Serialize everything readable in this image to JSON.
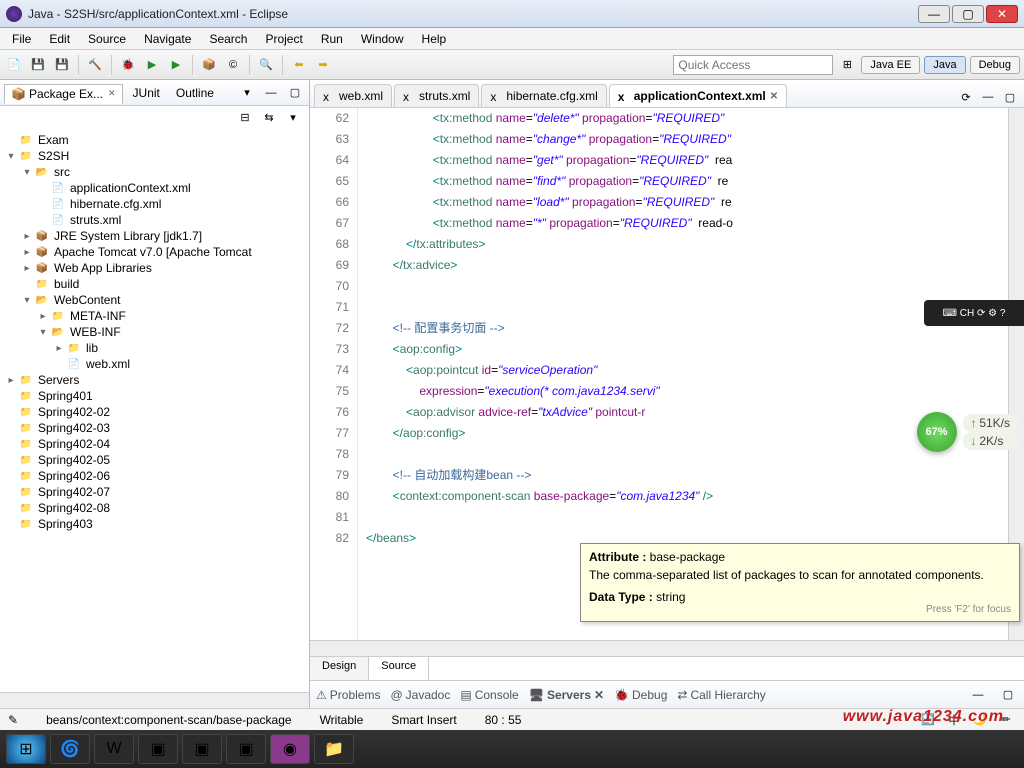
{
  "window": {
    "title": "Java - S2SH/src/applicationContext.xml - Eclipse"
  },
  "menu": [
    "File",
    "Edit",
    "Source",
    "Navigate",
    "Search",
    "Project",
    "Run",
    "Window",
    "Help"
  ],
  "quick_access": {
    "placeholder": "Quick Access"
  },
  "perspectives": {
    "java_ee": "Java EE",
    "java": "Java",
    "debug": "Debug"
  },
  "sidebar": {
    "tabs": {
      "package_explorer": "Package Ex...",
      "junit": "JUnit",
      "outline": "Outline"
    },
    "tree": [
      {
        "d": 0,
        "a": "",
        "i": "project-icon",
        "t": "Exam"
      },
      {
        "d": 0,
        "a": "▾",
        "i": "project-icon",
        "t": "S2SH"
      },
      {
        "d": 1,
        "a": "▾",
        "i": "folder-open",
        "t": "src"
      },
      {
        "d": 2,
        "a": "",
        "i": "file-icon",
        "t": "applicationContext.xml"
      },
      {
        "d": 2,
        "a": "",
        "i": "file-icon",
        "t": "hibernate.cfg.xml"
      },
      {
        "d": 2,
        "a": "",
        "i": "file-icon",
        "t": "struts.xml"
      },
      {
        "d": 1,
        "a": "▸",
        "i": "jar-icon",
        "t": "JRE System Library [jdk1.7]"
      },
      {
        "d": 1,
        "a": "▸",
        "i": "jar-icon",
        "t": "Apache Tomcat v7.0 [Apache Tomcat"
      },
      {
        "d": 1,
        "a": "▸",
        "i": "jar-icon",
        "t": "Web App Libraries"
      },
      {
        "d": 1,
        "a": "",
        "i": "folder-icon",
        "t": "build"
      },
      {
        "d": 1,
        "a": "▾",
        "i": "folder-open",
        "t": "WebContent"
      },
      {
        "d": 2,
        "a": "▸",
        "i": "folder-icon",
        "t": "META-INF"
      },
      {
        "d": 2,
        "a": "▾",
        "i": "folder-open",
        "t": "WEB-INF"
      },
      {
        "d": 3,
        "a": "▸",
        "i": "folder-icon",
        "t": "lib"
      },
      {
        "d": 3,
        "a": "",
        "i": "file-icon",
        "t": "web.xml"
      },
      {
        "d": 0,
        "a": "▸",
        "i": "folder-icon",
        "t": "Servers"
      },
      {
        "d": 0,
        "a": "",
        "i": "project-icon",
        "t": "Spring401"
      },
      {
        "d": 0,
        "a": "",
        "i": "project-icon",
        "t": "Spring402-02"
      },
      {
        "d": 0,
        "a": "",
        "i": "project-icon",
        "t": "Spring402-03"
      },
      {
        "d": 0,
        "a": "",
        "i": "project-icon",
        "t": "Spring402-04"
      },
      {
        "d": 0,
        "a": "",
        "i": "project-icon",
        "t": "Spring402-05"
      },
      {
        "d": 0,
        "a": "",
        "i": "project-icon",
        "t": "Spring402-06"
      },
      {
        "d": 0,
        "a": "",
        "i": "project-icon",
        "t": "Spring402-07"
      },
      {
        "d": 0,
        "a": "",
        "i": "project-icon",
        "t": "Spring402-08"
      },
      {
        "d": 0,
        "a": "",
        "i": "project-icon",
        "t": "Spring403"
      }
    ]
  },
  "editor": {
    "tabs": [
      "web.xml",
      "struts.xml",
      "hibernate.cfg.xml",
      "applicationContext.xml"
    ],
    "active_tab": 3,
    "design_source": {
      "design": "Design",
      "source": "Source"
    },
    "lines": [
      {
        "n": 62,
        "html": "                    <span class='sym'>&lt;</span><span class='tag'>tx:method</span> <span class='attr'>name</span>=<span class='str'>&quot;delete*&quot;</span> <span class='attr'>propagation</span>=<span class='str'>&quot;REQUIRED&quot;</span>"
      },
      {
        "n": 63,
        "html": "                    <span class='sym'>&lt;</span><span class='tag'>tx:method</span> <span class='attr'>name</span>=<span class='str'>&quot;change*&quot;</span> <span class='attr'>propagation</span>=<span class='str'>&quot;REQUIRED&quot;</span>"
      },
      {
        "n": 64,
        "html": "                    <span class='sym'>&lt;</span><span class='tag'>tx:method</span> <span class='attr'>name</span>=<span class='str'>&quot;get*&quot;</span> <span class='attr'>propagation</span>=<span class='str'>&quot;REQUIRED&quot;</span>  rea"
      },
      {
        "n": 65,
        "html": "                    <span class='sym'>&lt;</span><span class='tag'>tx:method</span> <span class='attr'>name</span>=<span class='str'>&quot;find*&quot;</span> <span class='attr'>propagation</span>=<span class='str'>&quot;REQUIRED&quot;</span>  re"
      },
      {
        "n": 66,
        "html": "                    <span class='sym'>&lt;</span><span class='tag'>tx:method</span> <span class='attr'>name</span>=<span class='str'>&quot;load*&quot;</span> <span class='attr'>propagation</span>=<span class='str'>&quot;REQUIRED&quot;</span>  re"
      },
      {
        "n": 67,
        "html": "                    <span class='sym'>&lt;</span><span class='tag'>tx:method</span> <span class='attr'>name</span>=<span class='str'>&quot;*&quot;</span> <span class='attr'>propagation</span>=<span class='str'>&quot;REQUIRED&quot;</span>  read-o"
      },
      {
        "n": 68,
        "html": "            <span class='sym'>&lt;/</span><span class='tag'>tx:attributes</span><span class='sym'>&gt;</span>"
      },
      {
        "n": 69,
        "html": "        <span class='sym'>&lt;/</span><span class='tag'>tx:advice</span><span class='sym'>&gt;</span>"
      },
      {
        "n": 70,
        "html": ""
      },
      {
        "n": 71,
        "html": ""
      },
      {
        "n": 72,
        "html": "        <span class='cmt'>&lt;!-- 配置事务切面 --&gt;</span>"
      },
      {
        "n": 73,
        "html": "        <span class='sym'>&lt;</span><span class='tag'>aop:config</span><span class='sym'>&gt;</span>"
      },
      {
        "n": 74,
        "html": "            <span class='sym'>&lt;</span><span class='tag'>aop:pointcut</span> <span class='attr'>id</span>=<span class='str'>&quot;serviceOperation&quot;</span>"
      },
      {
        "n": 75,
        "html": "                <span class='attr'>expression</span>=<span class='str'>&quot;execution(* com.java1234.servi&quot;</span>"
      },
      {
        "n": 76,
        "html": "            <span class='sym'>&lt;</span><span class='tag'>aop:advisor</span> <span class='attr'>advice-ref</span>=<span class='str'>&quot;txAdvice&quot;</span> <span class='attr'>pointcut-r</span>"
      },
      {
        "n": 77,
        "html": "        <span class='sym'>&lt;/</span><span class='tag'>aop:config</span><span class='sym'>&gt;</span>"
      },
      {
        "n": 78,
        "html": ""
      },
      {
        "n": 79,
        "html": "        <span class='cmt'>&lt;!-- 自动加载构建bean --&gt;</span>"
      },
      {
        "n": 80,
        "html": "        <span class='sym'>&lt;</span><span class='tag'>context:component-scan</span> <span class='attr'>base-package</span>=<span class='str'>&quot;com.java1234&quot;</span> <span class='sym'>/&gt;</span>"
      },
      {
        "n": 81,
        "html": ""
      },
      {
        "n": 82,
        "html": "<span class='sym'>&lt;/</span><span class='tag'>beans</span><span class='sym'>&gt;</span>"
      }
    ]
  },
  "tooltip": {
    "title_label": "Attribute :",
    "title_value": "base-package",
    "body": "The comma-separated list of packages to scan for annotated components.",
    "dt_label": "Data Type :",
    "dt_value": "string",
    "foot": "Press 'F2' for focus"
  },
  "bottom_views": [
    "Problems",
    "Javadoc",
    "Console",
    "Servers",
    "Debug",
    "Call Hierarchy"
  ],
  "statusbar": {
    "path": "beans/context:component-scan/base-package",
    "mode": "Writable",
    "insert": "Smart Insert",
    "pos": "80 : 55"
  },
  "speed": {
    "percent": "67%",
    "up": "51K/s",
    "down": "2K/s"
  },
  "watermark": "www.java1234.com"
}
